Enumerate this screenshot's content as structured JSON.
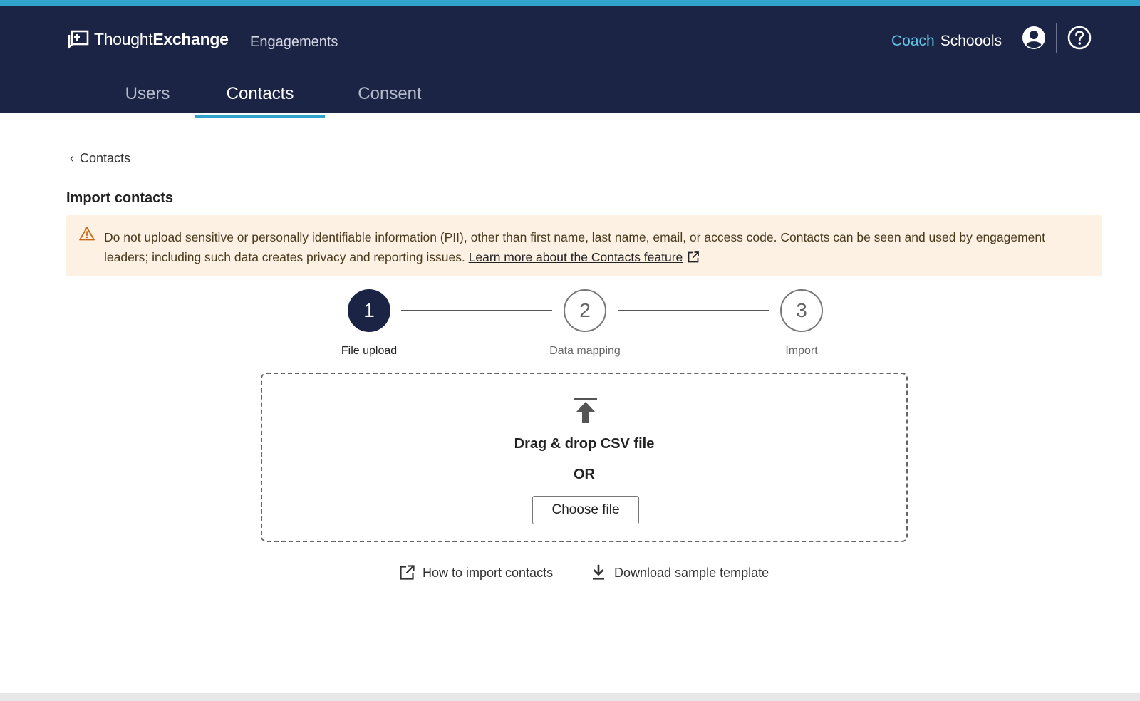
{
  "app": {
    "logo_light": "Thought",
    "logo_bold": "Exchange",
    "nav_engagements": "Engagements",
    "org_prefix": "Coach",
    "org_name": "Schoools"
  },
  "tabs": [
    {
      "label": "Users",
      "active": false
    },
    {
      "label": "Contacts",
      "active": true
    },
    {
      "label": "Consent",
      "active": false
    }
  ],
  "breadcrumb": {
    "back_label": "Contacts"
  },
  "page": {
    "title": "Import contacts"
  },
  "warning": {
    "text": "Do not upload sensitive or personally identifiable information (PII), other than first name, last name, email, or access code. Contacts can be seen and used by engagement leaders; including such data creates privacy and reporting issues.",
    "link_label": "Learn more about the Contacts feature"
  },
  "stepper": {
    "steps": [
      {
        "number": "1",
        "label": "File upload",
        "state": "current"
      },
      {
        "number": "2",
        "label": "Data mapping",
        "state": "pending"
      },
      {
        "number": "3",
        "label": "Import",
        "state": "pending"
      }
    ]
  },
  "dropzone": {
    "drag_text": "Drag & drop CSV file",
    "or_text": "OR",
    "choose_label": "Choose file"
  },
  "links": {
    "how_to": "How to import contacts",
    "download": "Download sample template"
  },
  "colors": {
    "header_bg": "#1b2444",
    "accent": "#2fa3cc",
    "warning_bg": "#fdf1e4",
    "warning_icon": "#c96a1a"
  },
  "icons": {
    "logo": "thoughtexchange-logo-icon",
    "user": "user-account-icon",
    "help": "help-question-icon",
    "warning": "warning-triangle-icon",
    "external": "external-link-icon",
    "upload": "upload-arrow-icon",
    "download": "download-icon",
    "back": "chevron-left-icon"
  }
}
